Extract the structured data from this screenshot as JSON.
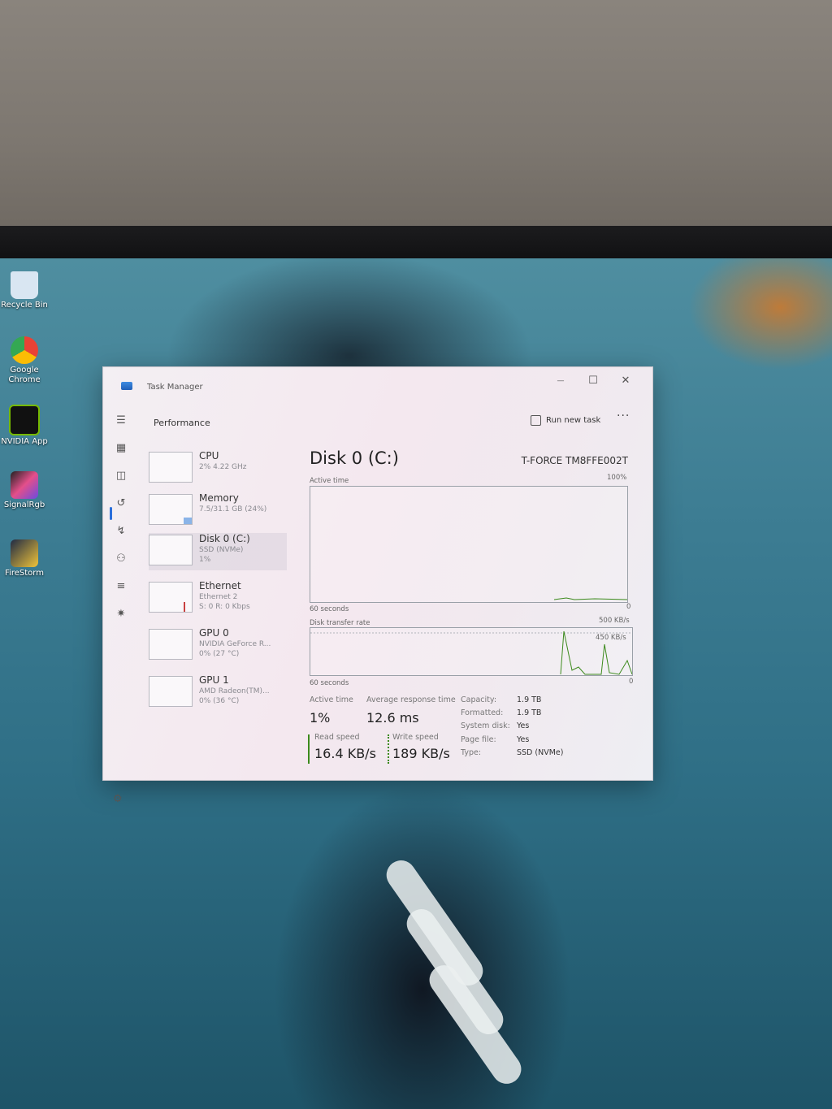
{
  "desktop": {
    "icons": [
      {
        "label": "Recycle Bin",
        "icon": "recycle-bin-icon",
        "color": "#d9e6f2"
      },
      {
        "label": "Google Chrome",
        "icon": "chrome-icon",
        "color": "#e94235"
      },
      {
        "label": "NVIDIA App",
        "icon": "nvidia-icon",
        "color": "#76b900"
      },
      {
        "label": "SignalRgb",
        "icon": "signalrgb-icon",
        "color": "#e44f8a"
      },
      {
        "label": "FireStorm",
        "icon": "firestorm-icon",
        "color": "#1f2a44"
      }
    ]
  },
  "window": {
    "title": "Task Manager",
    "minimize": "—",
    "maximize": "☐",
    "close": "✕"
  },
  "header": {
    "title": "Performance",
    "run_new_task": "Run new task",
    "more": "···"
  },
  "devices": [
    {
      "name": "CPU",
      "sub1": "2% 4.22 GHz",
      "sub2": ""
    },
    {
      "name": "Memory",
      "sub1": "7.5/31.1 GB (24%)",
      "sub2": ""
    },
    {
      "name": "Disk 0 (C:)",
      "sub1": "SSD (NVMe)",
      "sub2": "1%"
    },
    {
      "name": "Ethernet",
      "sub1": "Ethernet 2",
      "sub2": "S: 0 R: 0 Kbps"
    },
    {
      "name": "GPU 0",
      "sub1": "NVIDIA GeForce R...",
      "sub2": "0% (27 °C)"
    },
    {
      "name": "GPU 1",
      "sub1": "AMD Radeon(TM)...",
      "sub2": "0% (36 °C)"
    }
  ],
  "detail": {
    "title": "Disk 0 (C:)",
    "model": "T-FORCE TM8FFE002T",
    "active_time_graph": {
      "label": "Active time",
      "max": "100%",
      "min": "0",
      "span": "60 seconds"
    },
    "transfer_graph": {
      "label": "Disk transfer rate",
      "max": "500 KB/s",
      "mid": "450 KB/s",
      "min": "0",
      "span": "60 seconds"
    },
    "stats": {
      "active_time_label": "Active time",
      "active_time": "1%",
      "avg_response_label": "Average response time",
      "avg_response": "12.6 ms",
      "read_label": "Read speed",
      "read": "16.4 KB/s",
      "write_label": "Write speed",
      "write": "189 KB/s"
    },
    "props": [
      {
        "k": "Capacity:",
        "v": "1.9 TB"
      },
      {
        "k": "Formatted:",
        "v": "1.9 TB"
      },
      {
        "k": "System disk:",
        "v": "Yes"
      },
      {
        "k": "Page file:",
        "v": "Yes"
      },
      {
        "k": "Type:",
        "v": "SSD (NVMe)"
      }
    ]
  },
  "colors": {
    "accent": "#2a6fdb",
    "graph_line": "#3c8a1c"
  }
}
